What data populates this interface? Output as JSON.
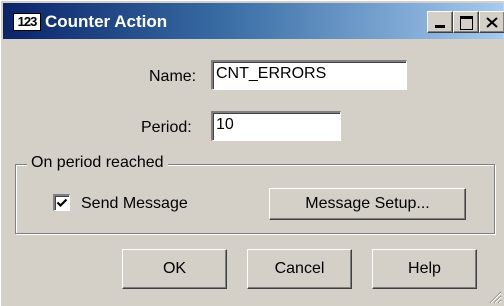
{
  "window": {
    "icon_text": "123",
    "title": "Counter Action"
  },
  "form": {
    "name_label": "Name:",
    "name_value": "CNT_ERRORS",
    "period_label": "Period:",
    "period_value": "10"
  },
  "group": {
    "title": "On period reached",
    "send_message_label": "Send Message",
    "send_message_checked": true,
    "message_setup_label": "Message Setup..."
  },
  "buttons": {
    "ok": "OK",
    "cancel": "Cancel",
    "help": "Help"
  }
}
